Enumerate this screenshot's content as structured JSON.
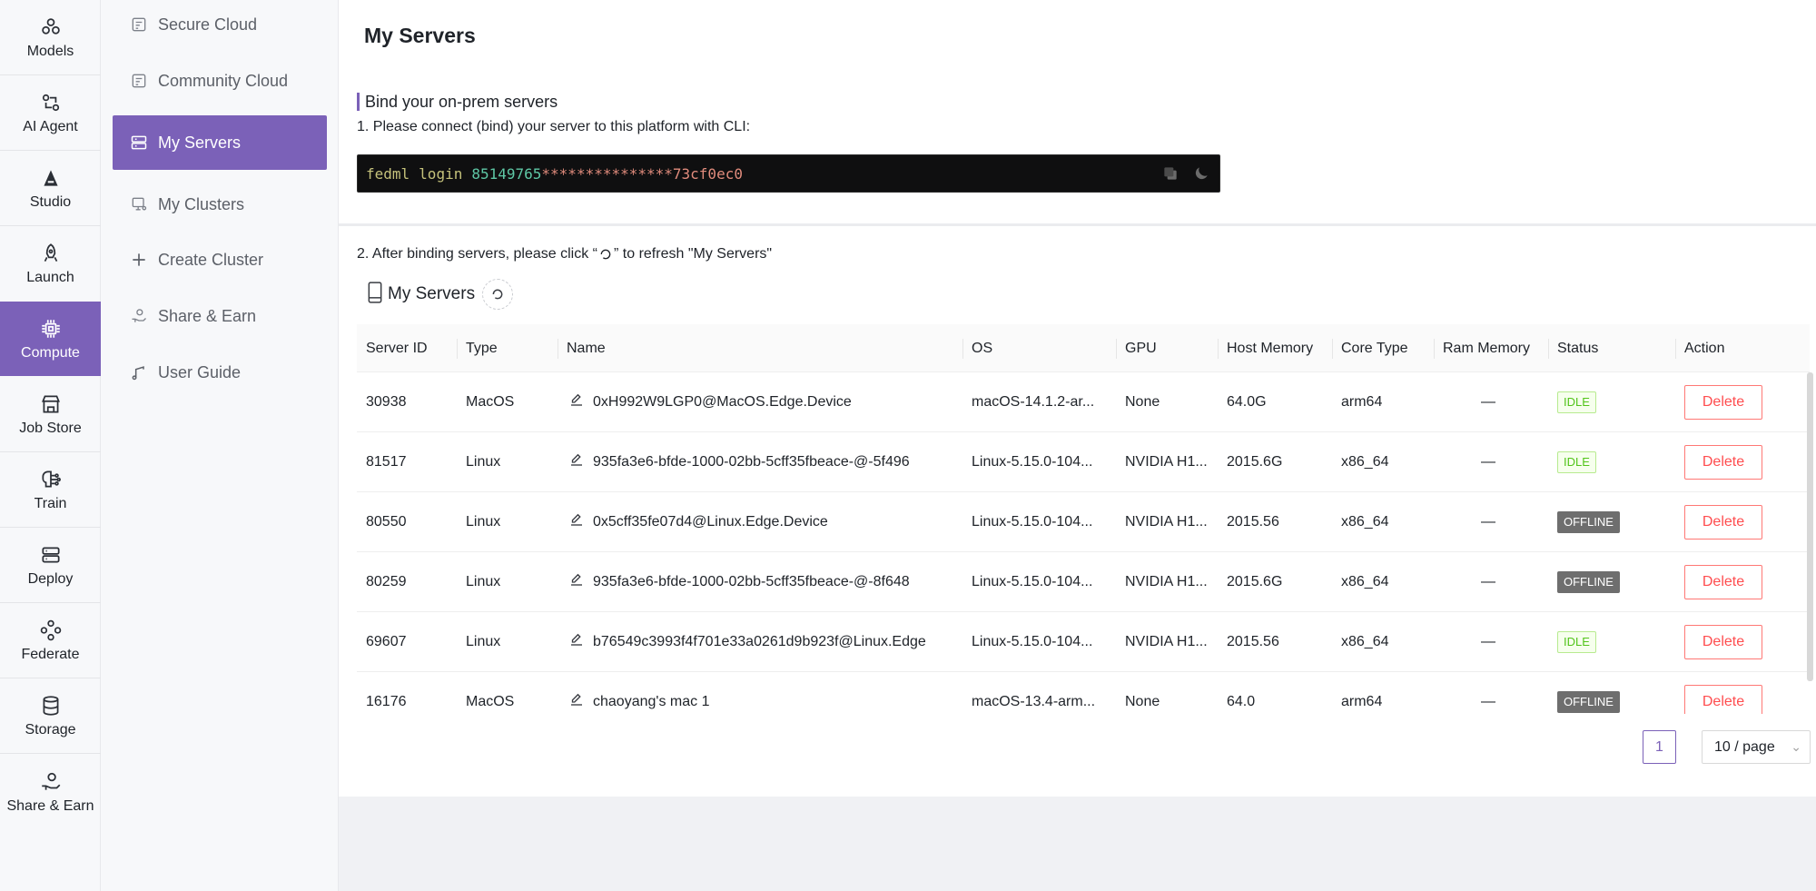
{
  "rail": {
    "items": [
      {
        "label": "Models",
        "icon": "models-icon"
      },
      {
        "label": "AI Agent",
        "icon": "ai-agent-icon"
      },
      {
        "label": "Studio",
        "icon": "studio-icon"
      },
      {
        "label": "Launch",
        "icon": "rocket-icon"
      },
      {
        "label": "Compute",
        "icon": "chip-icon",
        "active": true
      },
      {
        "label": "Job Store",
        "icon": "store-icon"
      },
      {
        "label": "Train",
        "icon": "train-icon"
      },
      {
        "label": "Deploy",
        "icon": "server-stack-icon"
      },
      {
        "label": "Federate",
        "icon": "federate-icon"
      },
      {
        "label": "Storage",
        "icon": "database-icon"
      },
      {
        "label": "Share & Earn",
        "icon": "share-earn-icon"
      }
    ]
  },
  "subnav": {
    "items": [
      {
        "label": "Secure Cloud",
        "icon": "secure-cloud-icon"
      },
      {
        "label": "Community Cloud",
        "icon": "community-cloud-icon"
      },
      {
        "label": "My Servers",
        "icon": "servers-icon",
        "active": true
      },
      {
        "label": "My Clusters",
        "icon": "clusters-icon"
      },
      {
        "label": "Create Cluster",
        "icon": "plus-icon"
      },
      {
        "label": "Share & Earn",
        "icon": "share-earn-icon"
      },
      {
        "label": "User Guide",
        "icon": "guide-icon"
      }
    ]
  },
  "main": {
    "title": "My Servers",
    "bind_heading": "Bind your on-prem servers",
    "step1": "1. Please connect (bind) your server to this platform with CLI:",
    "cli": {
      "cmd": "fedml",
      "sub": "login",
      "key_visible": "85149765",
      "key_masked": "***************73cf0ec0"
    },
    "step2_before": "2. After binding servers, please click “",
    "step2_after": "” to refresh \"My Servers\"",
    "servers_heading": "My Servers"
  },
  "table": {
    "headers": [
      "Server ID",
      "Type",
      "Name",
      "OS",
      "GPU",
      "Host Memory",
      "Core Type",
      "Ram Memory",
      "Status",
      "Action"
    ],
    "rows": [
      {
        "id": "30938",
        "type": "MacOS",
        "name": "0xH992W9LGP0@MacOS.Edge.Device",
        "os": "macOS-14.1.2-ar...",
        "gpu": "None",
        "host_memory": "64.0G",
        "core": "arm64",
        "ram": "—",
        "status": "IDLE",
        "action": "Delete"
      },
      {
        "id": "81517",
        "type": "Linux",
        "name": "935fa3e6-bfde-1000-02bb-5cff35fbeace-@-5f496",
        "os": "Linux-5.15.0-104...",
        "gpu": "NVIDIA H1...",
        "host_memory": "2015.6G",
        "core": "x86_64",
        "ram": "—",
        "status": "IDLE",
        "action": "Delete"
      },
      {
        "id": "80550",
        "type": "Linux",
        "name": "0x5cff35fe07d4@Linux.Edge.Device",
        "os": "Linux-5.15.0-104...",
        "gpu": "NVIDIA H1...",
        "host_memory": "2015.56",
        "core": "x86_64",
        "ram": "—",
        "status": "OFFLINE",
        "action": "Delete"
      },
      {
        "id": "80259",
        "type": "Linux",
        "name": "935fa3e6-bfde-1000-02bb-5cff35fbeace-@-8f648",
        "os": "Linux-5.15.0-104...",
        "gpu": "NVIDIA H1...",
        "host_memory": "2015.6G",
        "core": "x86_64",
        "ram": "—",
        "status": "OFFLINE",
        "action": "Delete"
      },
      {
        "id": "69607",
        "type": "Linux",
        "name": "b76549c3993f4f701e33a0261d9b923f@Linux.Edge",
        "os": "Linux-5.15.0-104...",
        "gpu": "NVIDIA H1...",
        "host_memory": "2015.56",
        "core": "x86_64",
        "ram": "—",
        "status": "IDLE",
        "action": "Delete"
      },
      {
        "id": "16176",
        "type": "MacOS",
        "name": "chaoyang's mac 1",
        "os": "macOS-13.4-arm...",
        "gpu": "None",
        "host_memory": "64.0",
        "core": "arm64",
        "ram": "—",
        "status": "OFFLINE",
        "action": "Delete"
      }
    ]
  },
  "pagination": {
    "current": "1",
    "page_size": "10 / page"
  },
  "colors": {
    "accent": "#7b61b8",
    "idle": "#52c41a",
    "offline": "#6e6e6e",
    "danger": "#ff4d4f"
  }
}
